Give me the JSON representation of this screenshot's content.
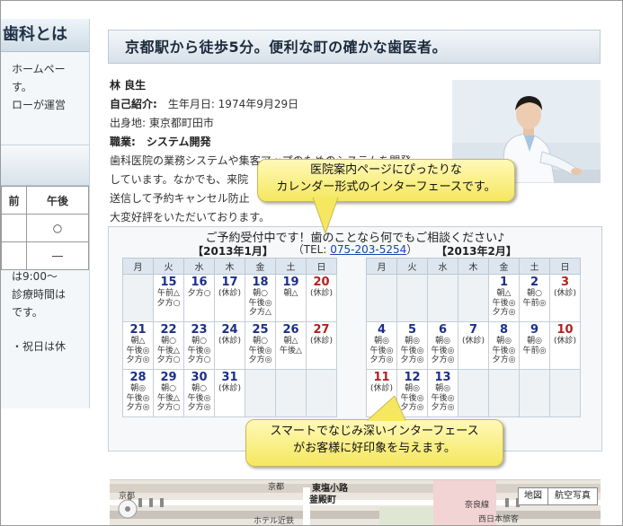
{
  "sidebar": {
    "heading": "歯科とは",
    "lines": [
      "ホームペー",
      "す。",
      "ローが運営"
    ],
    "table": {
      "headers": [
        "前",
        "午後"
      ],
      "rows": [
        [
          "",
          "○"
        ],
        [
          "",
          "―"
        ]
      ]
    },
    "notes": [
      "は9:00～",
      "診療時間は",
      "です。",
      "・祝日は休"
    ]
  },
  "page": {
    "title": "京都駅から徒歩5分。便利な町の確かな歯医者。"
  },
  "profile": {
    "name": "林 良生",
    "intro_label": "自己紹介:",
    "birth": "生年月日: 1974年9月29日",
    "hometown": "出身地: 東京都町田市",
    "job_label": "職業:",
    "job_value": "システム開発",
    "desc_lines": [
      "歯科医院の業務システムや集客アップのためのシステムを開発",
      "しています。なかでも、来院",
      "送信して予約キャンセル防止",
      "大変好評をいただいております。"
    ]
  },
  "callouts": {
    "top": [
      "医院案内ページにぴったりな",
      "カレンダー形式のインターフェースです。"
    ],
    "bottom": [
      "スマートでなじみ深いインターフェース",
      "がお客様に好印象を与えます。"
    ]
  },
  "calendar": {
    "headline": "ご予約受付中です！歯のことなら何でもご相談ください♪",
    "tel_prefix": "（TEL: ",
    "tel": "075-203-5254",
    "tel_suffix": "）",
    "weekdays": [
      "月",
      "火",
      "水",
      "木",
      "金",
      "土",
      "日"
    ],
    "months": [
      {
        "title": "【2013年1月】",
        "weeks": [
          [
            null,
            {
              "d": "15",
              "s": [
                "午前△",
                "夕方○"
              ]
            },
            {
              "d": "16",
              "s": [
                "夕方○"
              ]
            },
            {
              "d": "17",
              "s": [
                "(休診)"
              ]
            },
            {
              "d": "18",
              "s": [
                "朝○",
                "午後◎",
                "夕方△"
              ]
            },
            {
              "d": "19",
              "s": [
                "朝△"
              ]
            },
            {
              "d": "20",
              "sun": true,
              "s": [
                "(休診)"
              ]
            }
          ],
          [
            {
              "d": "21",
              "s": [
                "朝△",
                "午後◎",
                "夕方◎"
              ]
            },
            {
              "d": "22",
              "s": [
                "朝○",
                "午後△",
                "夕方○"
              ]
            },
            {
              "d": "23",
              "s": [
                "朝○",
                "午後◎",
                "夕方○"
              ]
            },
            {
              "d": "24",
              "s": [
                "(休診)"
              ]
            },
            {
              "d": "25",
              "s": [
                "朝○",
                "午後◎",
                "夕方◎"
              ]
            },
            {
              "d": "26",
              "s": [
                "朝△",
                "午後△"
              ]
            },
            {
              "d": "27",
              "sun": true,
              "s": [
                "(休診)"
              ]
            }
          ],
          [
            {
              "d": "28",
              "s": [
                "朝◎",
                "午後◎",
                "夕方◎"
              ]
            },
            {
              "d": "29",
              "s": [
                "朝○",
                "午後△",
                "夕方○"
              ]
            },
            {
              "d": "30",
              "s": [
                "朝○",
                "午後◎",
                "夕方◎"
              ]
            },
            {
              "d": "31",
              "s": [
                "(休診)"
              ]
            },
            null,
            null,
            null
          ]
        ]
      },
      {
        "title": "【2013年2月】",
        "weeks": [
          [
            null,
            null,
            null,
            null,
            {
              "d": "1",
              "s": [
                "朝△",
                "午後◎",
                "夕方◎"
              ]
            },
            {
              "d": "2",
              "s": [
                "朝○",
                "午前◎"
              ]
            },
            {
              "d": "3",
              "sun": true,
              "s": [
                "(休診)"
              ]
            }
          ],
          [
            {
              "d": "4",
              "s": [
                "朝◎",
                "午後◎",
                "夕方◎"
              ]
            },
            {
              "d": "5",
              "s": [
                "朝◎",
                "午後◎",
                "夕方◎"
              ]
            },
            {
              "d": "6",
              "s": [
                "朝◎",
                "午後◎",
                "夕方◎"
              ]
            },
            {
              "d": "7",
              "s": [
                "(休診)"
              ]
            },
            {
              "d": "8",
              "s": [
                "朝◎",
                "午後◎",
                "夕方◎"
              ]
            },
            {
              "d": "9",
              "s": [
                "朝◎",
                "午前◎"
              ]
            },
            {
              "d": "10",
              "sun": true,
              "s": [
                "(休診)"
              ]
            }
          ],
          [
            {
              "d": "11",
              "sun": true,
              "s": [
                "(休診)"
              ]
            },
            {
              "d": "12",
              "s": [
                "朝◎",
                "午後◎",
                "夕方◎"
              ]
            },
            {
              "d": "13",
              "s": [
                "朝◎",
                "午後◎",
                "夕方◎"
              ]
            },
            null,
            null,
            null,
            null
          ]
        ]
      }
    ]
  },
  "map": {
    "labels": [
      "京都",
      "東塩小路",
      "釜殿町",
      "奈良線",
      "ホテル近鉄",
      "西日本旅客"
    ],
    "map_button": "地図",
    "satellite_button": "航空写真"
  },
  "colors": {
    "callout": "#f5e75f",
    "date_blue": "#1b2f8c",
    "date_red": "#b32020",
    "title_grad": "#d7e1ea"
  }
}
